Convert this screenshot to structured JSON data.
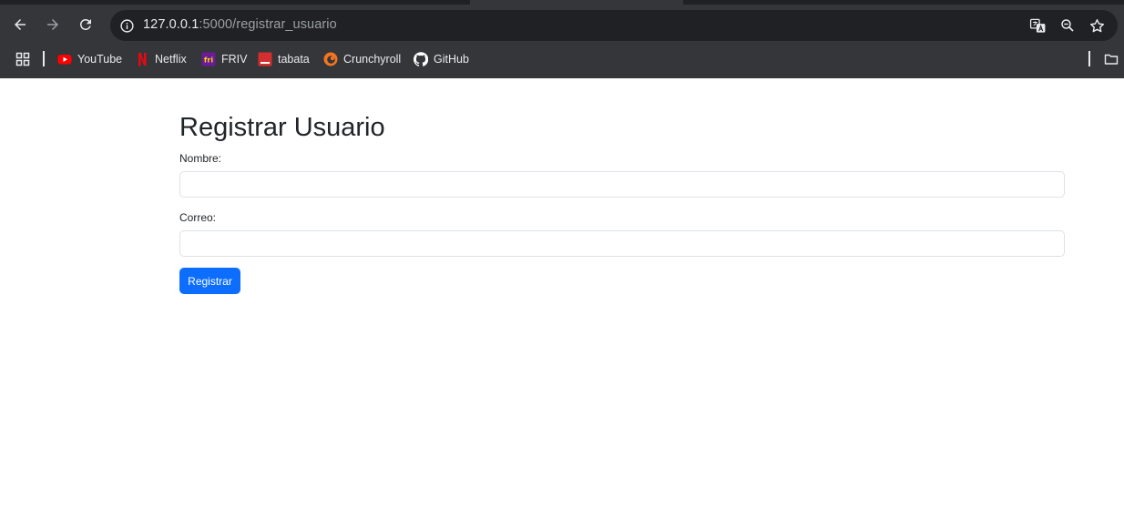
{
  "browser": {
    "url_host": "127.0.0.1",
    "url_path": ":5000/registrar_usuario",
    "icons": {
      "back": "arrow-left-icon",
      "forward": "arrow-right-icon",
      "reload": "reload-icon",
      "site_info": "info-icon",
      "translate": "translate-icon",
      "zoom": "zoom-out-icon",
      "bookmark": "star-icon",
      "apps": "apps-grid-icon",
      "folder": "folder-icon"
    },
    "bookmarks": [
      {
        "label": "YouTube",
        "icon": "youtube-icon",
        "color": "#ff0000"
      },
      {
        "label": "Netflix",
        "icon": "netflix-icon",
        "color": "#e50914"
      },
      {
        "label": "FRIV",
        "icon": "friv-icon",
        "color": "#6a1b9a"
      },
      {
        "label": "tabata",
        "icon": "tabata-icon",
        "color": "#d32f2f"
      },
      {
        "label": "Crunchyroll",
        "icon": "crunchyroll-icon",
        "color": "#f47521"
      },
      {
        "label": "GitHub",
        "icon": "github-icon",
        "color": "#ffffff"
      }
    ]
  },
  "form": {
    "title": "Registrar Usuario",
    "name_label": "Nombre:",
    "name_value": "",
    "email_label": "Correo:",
    "email_value": "",
    "submit_label": "Registrar"
  },
  "colors": {
    "chrome_bg": "#35363a",
    "omnibox_bg": "#202124",
    "primary": "#0d6efd",
    "text": "#212529",
    "border": "#dee2e6"
  }
}
